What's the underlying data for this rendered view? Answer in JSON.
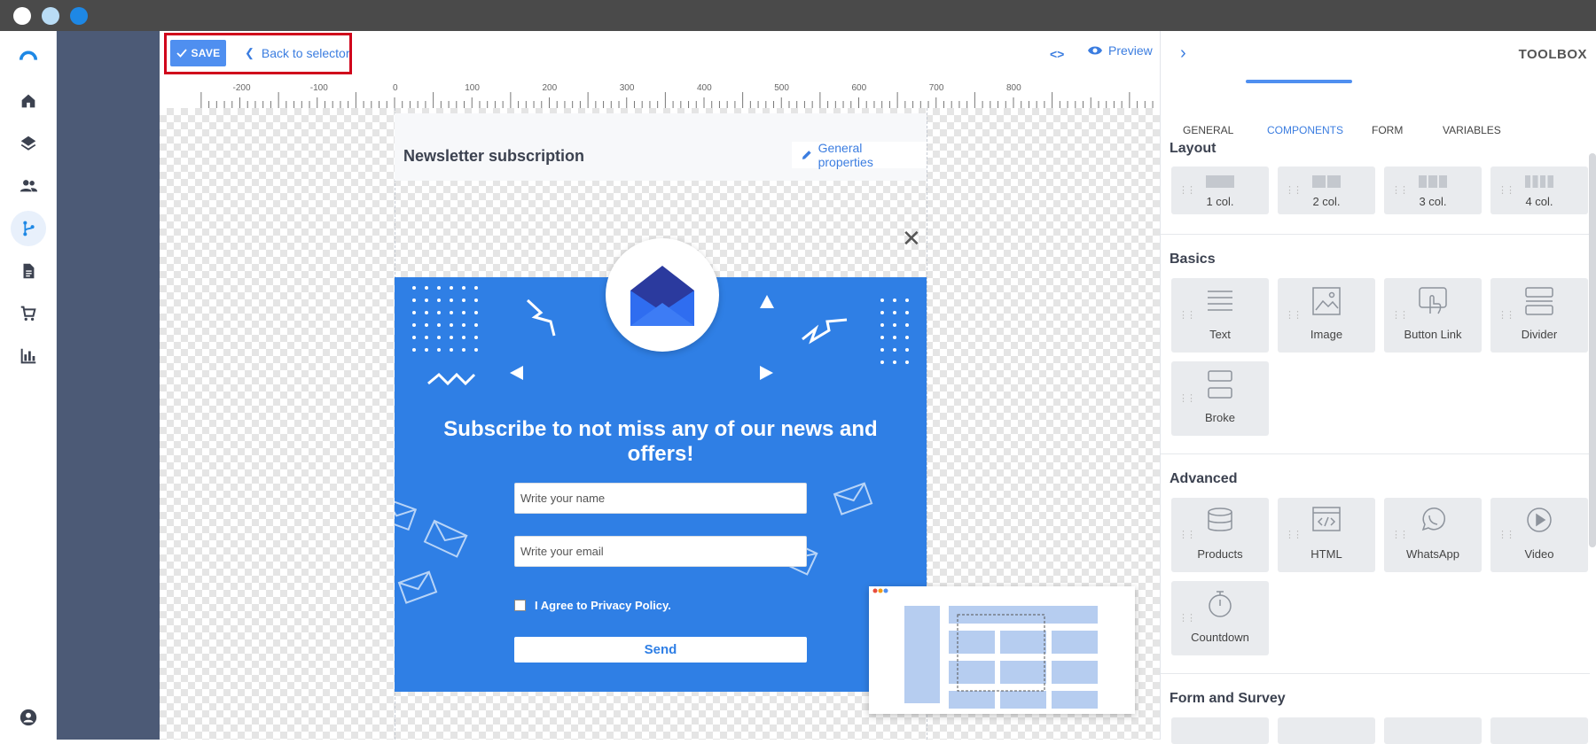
{
  "window": {
    "dots": [
      "#ffffff",
      "#b9dcf5",
      "#1e88e5"
    ]
  },
  "toolbar": {
    "save_label": "SAVE",
    "back_label": "Back to selector",
    "preview_label": "Preview"
  },
  "ruler": {
    "labels": [
      "-200",
      "-100",
      "0",
      "100",
      "200",
      "300",
      "400",
      "500",
      "600",
      "700",
      "800"
    ]
  },
  "canvas": {
    "page_title": "Newsletter subscription",
    "general_properties_label": "General properties"
  },
  "popup": {
    "title": "Subscribe to not miss any of our news and offers!",
    "name_placeholder": "Write your name",
    "email_placeholder": "Write your email",
    "agree_label": "I Agree to Privacy Policy.",
    "send_label": "Send"
  },
  "toolbox": {
    "title": "TOOLBOX",
    "tabs": [
      "GENERAL",
      "COMPONENTS",
      "FORM",
      "VARIABLES"
    ],
    "active_tab": "COMPONENTS",
    "sections": {
      "layout": {
        "title": "Layout",
        "items": [
          "1 col.",
          "2 col.",
          "3 col.",
          "4 col."
        ]
      },
      "basics": {
        "title": "Basics",
        "items": [
          "Text",
          "Image",
          "Button Link",
          "Divider",
          "Broke"
        ]
      },
      "advanced": {
        "title": "Advanced",
        "items": [
          "Products",
          "HTML",
          "WhatsApp",
          "Video",
          "Countdown"
        ]
      },
      "form_survey": {
        "title": "Form and Survey"
      }
    }
  },
  "colors": {
    "accent": "#4f8ff0",
    "popup_bg": "#2f7fe5",
    "highlight": "#d0021b",
    "sidebar_dark": "#4c5a76"
  }
}
